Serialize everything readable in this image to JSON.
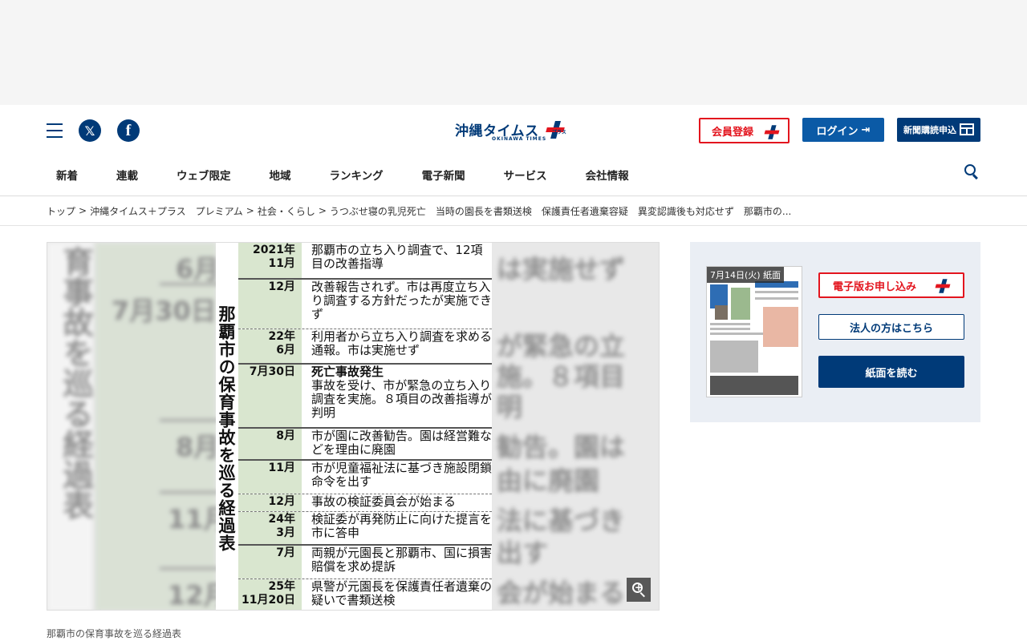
{
  "header": {
    "logo_text": "沖縄タイムス",
    "logo_sub": "OKINAWA TIMES",
    "logo_plus_text": "プラス",
    "register_label": "会員登録",
    "login_label": "ログイン",
    "subscribe_label": "新聞購読申込",
    "social": {
      "x": "𝕏",
      "facebook": "f"
    }
  },
  "nav": {
    "items": [
      "新着",
      "連載",
      "ウェブ限定",
      "地域",
      "ランキング",
      "電子新聞",
      "サービス",
      "会社情報"
    ]
  },
  "breadcrumb": {
    "items": [
      "トップ",
      "沖縄タイムス＋プラス　プレミアム",
      "社会・くらし",
      "うつぶせ寝の乳児死亡　当時の園長を書類送検　保護責任者遺棄容疑　異変認識後も対応せず　那覇市の..."
    ],
    "separator": ">"
  },
  "article": {
    "infographic_title": "那覇市の保育事故を巡る経過表",
    "rows": [
      {
        "date": "2021年\n11月",
        "event": "那覇市の立ち入り調査で、12項目の改善指導",
        "bold": false
      },
      {
        "date": "12月",
        "event": "改善報告されず。市は再度立ち入り調査する方針だったが実施できず",
        "bold": false
      },
      {
        "date": "22年\n6月",
        "event": "利用者から立ち入り調査を求める通報。市は実施せず",
        "bold": false
      },
      {
        "date": "7月30日",
        "event_bold": "死亡事故発生",
        "event": "事故を受け、市が緊急の立ち入り調査を実施。８項目の改善指導が判明",
        "bold": true
      },
      {
        "date": "8月",
        "event": "市が園に改善勧告。園は経営難などを理由に廃園",
        "bold": false
      },
      {
        "date": "11月",
        "event": "市が児童福祉法に基づき施設閉鎖命令を出す",
        "bold": false
      },
      {
        "date": "12月",
        "event": "事故の検証委員会が始まる",
        "bold": false
      },
      {
        "date": "24年\n3月",
        "event": "検証委が再発防止に向けた提言を市に答申",
        "bold": false
      },
      {
        "date": "7月",
        "event": "両親が元園長と那覇市、国に損害賠償を求め提訴",
        "bold": false
      },
      {
        "date": "25年\n11月20日",
        "event": "県警が元園長を保護責任者遺棄の疑いで書類送検",
        "bold": false
      }
    ],
    "blur_text": {
      "left": "育事故を巡る経過表",
      "dates": [
        "6月",
        "7月30日",
        "8月",
        "11月",
        "12月"
      ],
      "right": [
        "は実施せず",
        "が緊急の立",
        "施。８項目",
        "明",
        "勧告。園は",
        "由に廃園",
        "法に基づき",
        "出す",
        "会が始まる"
      ]
    },
    "caption": "那覇市の保育事故を巡る経過表"
  },
  "sidebar": {
    "paper_date": "7月14日(火) 紙面",
    "denshi_label": "電子版お申し込み",
    "houjin_label": "法人の方はこちら",
    "read_label": "紙面を読む"
  }
}
